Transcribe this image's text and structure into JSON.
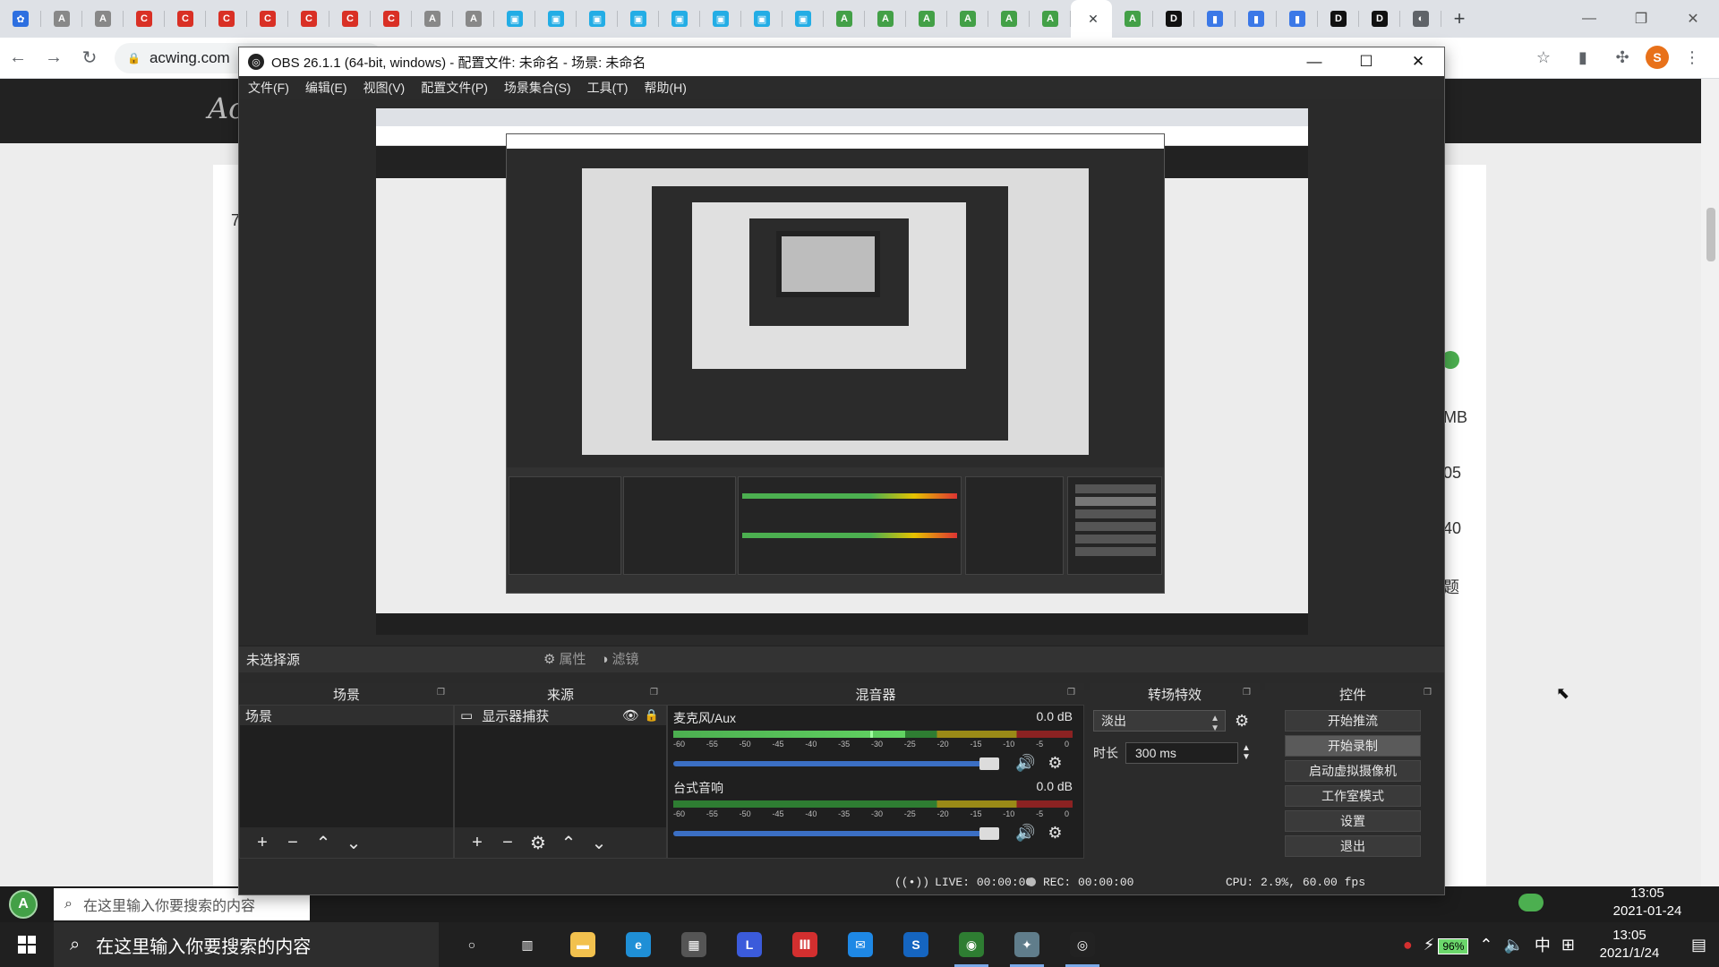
{
  "browser": {
    "url": "acwing.com",
    "profile_initial": "S",
    "tabs": [
      {
        "icon": "paw-icon",
        "color": "#2d6fe0",
        "glyph": "✿"
      },
      {
        "icon": "acwing-icon",
        "color": "#888",
        "glyph": "A"
      },
      {
        "icon": "acwing-icon",
        "color": "#888",
        "glyph": "A"
      },
      {
        "icon": "c-icon",
        "color": "#d93025",
        "glyph": "C"
      },
      {
        "icon": "c-icon",
        "color": "#d93025",
        "glyph": "C"
      },
      {
        "icon": "c-icon",
        "color": "#d93025",
        "glyph": "C"
      },
      {
        "icon": "c-icon",
        "color": "#d93025",
        "glyph": "C"
      },
      {
        "icon": "c-icon",
        "color": "#d93025",
        "glyph": "C"
      },
      {
        "icon": "c-icon",
        "color": "#d93025",
        "glyph": "C"
      },
      {
        "icon": "c-icon",
        "color": "#d93025",
        "glyph": "C"
      },
      {
        "icon": "acwing-icon",
        "color": "#888",
        "glyph": "A"
      },
      {
        "icon": "acwing-icon",
        "color": "#888",
        "glyph": "A"
      },
      {
        "icon": "bilibili-icon",
        "color": "#23ade5",
        "glyph": "▣"
      },
      {
        "icon": "bilibili-icon",
        "color": "#23ade5",
        "glyph": "▣"
      },
      {
        "icon": "bilibili-icon",
        "color": "#23ade5",
        "glyph": "▣"
      },
      {
        "icon": "bilibili-icon",
        "color": "#23ade5",
        "glyph": "▣"
      },
      {
        "icon": "bilibili-icon",
        "color": "#23ade5",
        "glyph": "▣"
      },
      {
        "icon": "bilibili-icon",
        "color": "#23ade5",
        "glyph": "▣"
      },
      {
        "icon": "bilibili-icon",
        "color": "#23ade5",
        "glyph": "▣"
      },
      {
        "icon": "bilibili-icon",
        "color": "#23ade5",
        "glyph": "▣"
      },
      {
        "icon": "green-a-icon",
        "color": "#43a047",
        "glyph": "A"
      },
      {
        "icon": "green-a-icon",
        "color": "#43a047",
        "glyph": "A"
      },
      {
        "icon": "green-a-icon",
        "color": "#43a047",
        "glyph": "A"
      },
      {
        "icon": "green-a-icon",
        "color": "#43a047",
        "glyph": "A"
      },
      {
        "icon": "green-a-icon",
        "color": "#43a047",
        "glyph": "A"
      },
      {
        "icon": "green-a-icon",
        "color": "#43a047",
        "glyph": "A"
      },
      {
        "icon": "active-tab",
        "color": "#fff",
        "glyph": "",
        "active": true
      },
      {
        "icon": "green-a-icon",
        "color": "#43a047",
        "glyph": "A"
      },
      {
        "icon": "dev-icon",
        "color": "#111",
        "glyph": "D"
      },
      {
        "icon": "chart-icon",
        "color": "#3b78e7",
        "glyph": "▮"
      },
      {
        "icon": "chart-icon",
        "color": "#3b78e7",
        "glyph": "▮"
      },
      {
        "icon": "chart-icon",
        "color": "#3b78e7",
        "glyph": "▮"
      },
      {
        "icon": "dev-icon",
        "color": "#111",
        "glyph": "D"
      },
      {
        "icon": "dev-icon",
        "color": "#111",
        "glyph": "D"
      },
      {
        "icon": "globe-icon",
        "color": "#5f6368",
        "glyph": "◐"
      }
    ],
    "page_peek": [
      "7",
      "7",
      "MB",
      "05",
      "40",
      "题"
    ]
  },
  "obs": {
    "title": "OBS 26.1.1 (64-bit, windows) - 配置文件: 未命名 - 场景: 未命名",
    "menu": [
      "文件(F)",
      "编辑(E)",
      "视图(V)",
      "配置文件(P)",
      "场景集合(S)",
      "工具(T)",
      "帮助(H)"
    ],
    "no_source_selected": "未选择源",
    "properties_label": "属性",
    "filters_label": "滤镜",
    "scenes": {
      "title": "场景",
      "items": [
        "场景"
      ]
    },
    "sources": {
      "title": "来源",
      "items": [
        "显示器捕获"
      ]
    },
    "mixer": {
      "title": "混音器",
      "channels": [
        {
          "name": "麦克风/Aux",
          "db": "0.0 dB",
          "level": 0.58
        },
        {
          "name": "台式音响",
          "db": "0.0 dB",
          "level": 0.0
        }
      ],
      "ticks": [
        "-60",
        "-55",
        "-50",
        "-45",
        "-40",
        "-35",
        "-30",
        "-25",
        "-20",
        "-15",
        "-10",
        "-5",
        "0"
      ]
    },
    "transitions": {
      "title": "转场特效",
      "selected": "淡出",
      "duration_label": "时长",
      "duration_value": "300 ms"
    },
    "controls": {
      "title": "控件",
      "buttons": [
        "开始推流",
        "开始录制",
        "启动虚拟摄像机",
        "工作室模式",
        "设置",
        "退出"
      ]
    },
    "status": {
      "live": "LIVE: 00:00:00",
      "rec": "REC: 00:00:00",
      "cpu": "CPU: 2.9%, 60.00 fps"
    }
  },
  "inner_taskbar": {
    "search_placeholder": "在这里输入你要搜索的内容",
    "time": "13:05",
    "date": "2021-01-24"
  },
  "taskbar": {
    "search_placeholder": "在这里输入你要搜索的内容",
    "apps": [
      {
        "icon": "cortana-icon",
        "color": "#202020",
        "glyph": "○"
      },
      {
        "icon": "task-view-icon",
        "color": "#202020",
        "glyph": "▥"
      },
      {
        "icon": "file-explorer-icon",
        "color": "#f2c14e",
        "glyph": "▬"
      },
      {
        "icon": "edge-icon",
        "color": "#1f8fd6",
        "glyph": "e"
      },
      {
        "icon": "store-icon",
        "color": "#555",
        "glyph": "▦"
      },
      {
        "icon": "clock-app-icon",
        "color": "#3b5bdb",
        "glyph": "L"
      },
      {
        "icon": "red-app-icon",
        "color": "#d32f2f",
        "glyph": "Ⅲ"
      },
      {
        "icon": "mail-icon",
        "color": "#1e88e5",
        "glyph": "✉"
      },
      {
        "icon": "s-app-icon",
        "color": "#1565c0",
        "glyph": "S"
      },
      {
        "icon": "chrome-icon",
        "color": "#2e7d32",
        "glyph": "◉"
      },
      {
        "icon": "game-icon",
        "color": "#607d8b",
        "glyph": "✦"
      },
      {
        "icon": "obs-icon",
        "color": "#222",
        "glyph": "◎"
      }
    ],
    "battery": "96%",
    "ime": "中",
    "time": "13:05",
    "date": "2021/1/24"
  }
}
